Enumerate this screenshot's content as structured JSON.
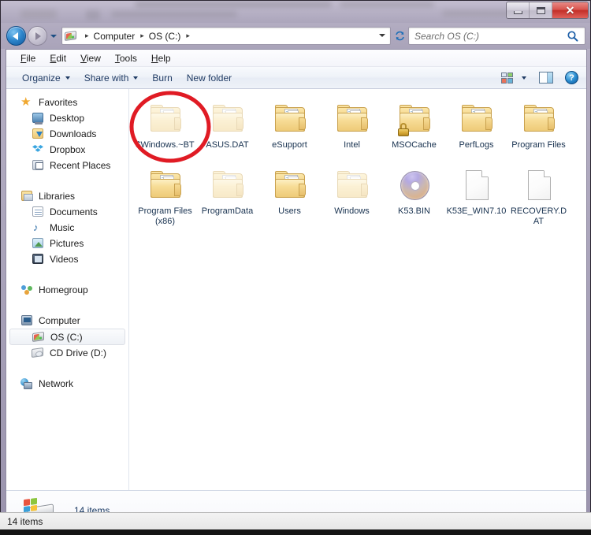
{
  "window": {
    "controls": {
      "minimize_label": "Minimize",
      "maximize_label": "Maximize",
      "close_label": "✕"
    }
  },
  "address_bar": {
    "back_label": "Back",
    "forward_label": "Forward",
    "history_label": "Recent pages",
    "refresh_label": "Refresh",
    "breadcrumb": [
      {
        "label": "Computer"
      },
      {
        "label": "OS (C:)"
      }
    ],
    "separator": "▸"
  },
  "search": {
    "placeholder": "Search OS (C:)",
    "value": "",
    "icon": "search-icon"
  },
  "menubar": {
    "items": [
      {
        "accel": "F",
        "rest": "ile"
      },
      {
        "accel": "E",
        "rest": "dit"
      },
      {
        "accel": "V",
        "rest": "iew"
      },
      {
        "accel": "T",
        "rest": "ools"
      },
      {
        "accel": "H",
        "rest": "elp"
      }
    ]
  },
  "toolbar": {
    "organize_label": "Organize",
    "share_label": "Share with",
    "burn_label": "Burn",
    "newfolder_label": "New folder",
    "help_label": "?",
    "view_icon": "view-layout-icon",
    "pane_icon": "preview-pane-icon"
  },
  "navpane": {
    "sections": [
      {
        "header": {
          "label": "Favorites",
          "icon": "star-icon"
        },
        "items": [
          {
            "label": "Desktop",
            "icon": "desktop-icon"
          },
          {
            "label": "Downloads",
            "icon": "downloads-icon"
          },
          {
            "label": "Dropbox",
            "icon": "dropbox-icon"
          },
          {
            "label": "Recent Places",
            "icon": "recent-places-icon"
          }
        ]
      },
      {
        "header": {
          "label": "Libraries",
          "icon": "libraries-icon"
        },
        "items": [
          {
            "label": "Documents",
            "icon": "documents-icon"
          },
          {
            "label": "Music",
            "icon": "music-icon"
          },
          {
            "label": "Pictures",
            "icon": "pictures-icon"
          },
          {
            "label": "Videos",
            "icon": "videos-icon"
          }
        ]
      },
      {
        "header": {
          "label": "Homegroup",
          "icon": "homegroup-icon"
        },
        "items": []
      },
      {
        "header": {
          "label": "Computer",
          "icon": "computer-icon"
        },
        "items": [
          {
            "label": "OS (C:)",
            "icon": "hard-drive-icon",
            "selected": true
          },
          {
            "label": "CD Drive (D:)",
            "icon": "cd-drive-icon",
            "selected": false
          }
        ]
      },
      {
        "header": {
          "label": "Network",
          "icon": "network-icon"
        },
        "items": []
      }
    ]
  },
  "files": [
    {
      "name": "$Windows.~BT",
      "type": "folder",
      "hidden": true,
      "locked": false,
      "annotated": true
    },
    {
      "name": "ASUS.DAT",
      "type": "folder",
      "hidden": true,
      "locked": false,
      "annotated": false
    },
    {
      "name": "eSupport",
      "type": "folder",
      "hidden": false,
      "locked": false,
      "annotated": false
    },
    {
      "name": "Intel",
      "type": "folder",
      "hidden": false,
      "locked": false,
      "annotated": false
    },
    {
      "name": "MSOCache",
      "type": "folder",
      "hidden": false,
      "locked": true,
      "annotated": false
    },
    {
      "name": "PerfLogs",
      "type": "folder",
      "hidden": false,
      "locked": false,
      "annotated": false
    },
    {
      "name": "Program Files",
      "type": "folder",
      "hidden": false,
      "locked": false,
      "annotated": false
    },
    {
      "name": "Program Files (x86)",
      "type": "folder",
      "hidden": false,
      "locked": false,
      "annotated": false
    },
    {
      "name": "ProgramData",
      "type": "folder",
      "hidden": true,
      "locked": false,
      "annotated": false
    },
    {
      "name": "Users",
      "type": "folder",
      "hidden": false,
      "locked": false,
      "annotated": false
    },
    {
      "name": "Windows",
      "type": "folder",
      "hidden": true,
      "locked": false,
      "annotated": false
    },
    {
      "name": "K53.BIN",
      "type": "disc",
      "hidden": false,
      "locked": false,
      "annotated": false
    },
    {
      "name": "K53E_WIN7.10",
      "type": "file",
      "hidden": false,
      "locked": false,
      "annotated": false
    },
    {
      "name": "RECOVERY.DAT",
      "type": "file",
      "hidden": false,
      "locked": false,
      "annotated": false
    }
  ],
  "details_pane": {
    "icon": "hard-drive-icon",
    "item_count_text": "14 items"
  },
  "status_bar": {
    "text": "14 items"
  },
  "annotation": {
    "shape": "ellipse",
    "color": "#e01b24",
    "target": "$Windows.~BT"
  }
}
